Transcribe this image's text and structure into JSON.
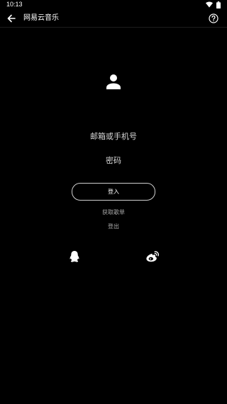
{
  "status_bar": {
    "time": "10:13",
    "icons": [
      "wifi-icon",
      "battery-icon"
    ]
  },
  "app_bar": {
    "title": "网易云音乐",
    "back_icon": "arrow-left-icon",
    "help_icon": "help-circle-icon"
  },
  "login": {
    "avatar_icon": "person-icon",
    "email_placeholder": "邮箱或手机号",
    "password_placeholder": "密码",
    "login_button": "登入",
    "get_playlist_link": "获取歌单",
    "logout_link": "登出"
  },
  "social": {
    "qq_icon": "qq-icon",
    "weibo_icon": "weibo-icon"
  },
  "colors": {
    "background": "#000000",
    "text": "#ffffff",
    "muted_text": "#a8a8a8",
    "button_border": "#cfcfcf"
  }
}
